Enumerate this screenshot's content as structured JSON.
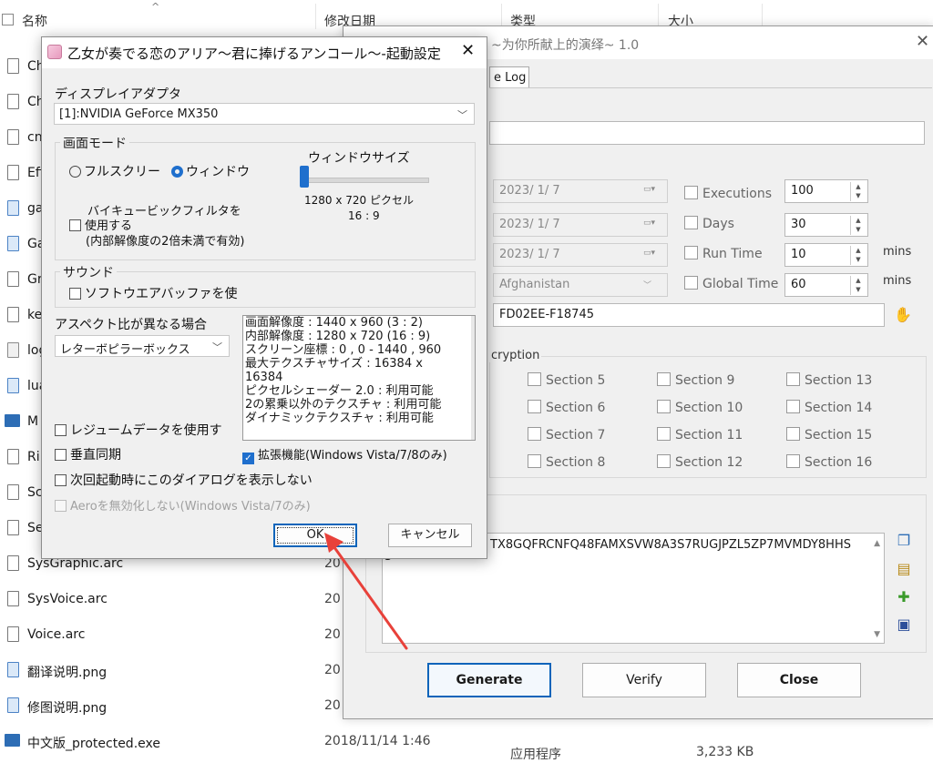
{
  "explorer": {
    "columns": {
      "name": "名称",
      "modified": "修改日期",
      "type": "类型",
      "size": "大小"
    },
    "files": [
      {
        "name": "Ch",
        "icon": "file"
      },
      {
        "name": "Ch",
        "icon": "file"
      },
      {
        "name": "cn",
        "icon": "file"
      },
      {
        "name": "Eff",
        "icon": "file"
      },
      {
        "name": "ga",
        "icon": "image"
      },
      {
        "name": "Ga",
        "icon": "image"
      },
      {
        "name": "Gr",
        "icon": "file"
      },
      {
        "name": "ke",
        "icon": "file"
      },
      {
        "name": "log",
        "icon": "text"
      },
      {
        "name": "lua",
        "icon": "image"
      },
      {
        "name": "M",
        "icon": "exe"
      },
      {
        "name": "Ri",
        "icon": "file"
      },
      {
        "name": "Sc",
        "icon": "file"
      },
      {
        "name": "Se",
        "icon": "file"
      },
      {
        "name": "SysGraphic.arc",
        "icon": "file",
        "date": "20"
      },
      {
        "name": "SysVoice.arc",
        "icon": "file",
        "date": "20"
      },
      {
        "name": "Voice.arc",
        "icon": "file",
        "date": "20"
      },
      {
        "name": "翻译说明.png",
        "icon": "image",
        "date": "20"
      },
      {
        "name": "修图说明.png",
        "icon": "image",
        "date": "20"
      },
      {
        "name": "中文版_protected.exe",
        "icon": "exe",
        "date": "2018/11/14 1:46"
      }
    ],
    "last_row_type": "应用程序",
    "last_row_size": "3,233 KB"
  },
  "keygen": {
    "title": "~为你所献上的演绎~ 1.0",
    "tab": "e Log",
    "dates": [
      "2023/ 1/ 7",
      "2023/ 1/ 7",
      "2023/ 1/ 7"
    ],
    "country": "Afghanistan",
    "hwid": "FD02EE-F18745",
    "checks": {
      "executions": "Executions",
      "days": "Days",
      "run_time": "Run Time",
      "global_time": "Global Time"
    },
    "values": {
      "executions": "100",
      "days": "30",
      "run_time": "10",
      "global_time": "60"
    },
    "units": {
      "mins1": "mins",
      "mins2": "mins"
    },
    "encryption_label": "cryption",
    "sections": [
      "Section 5",
      "Section 6",
      "Section 7",
      "Section 8",
      "Section 9",
      "Section 10",
      "Section 11",
      "Section 12",
      "Section 13",
      "Section 14",
      "Section 15",
      "Section 16"
    ],
    "key_text": "TX8GQFRCNFQ48FAMXSVW8A3S7RUGJPZL5ZP7MVMDY8HHS",
    "key_text_line2": "3",
    "buttons": {
      "generate": "Generate",
      "verify": "Verify",
      "close": "Close"
    }
  },
  "setup": {
    "title": "乙女が奏でる恋のアリア～君に捧げるアンコール～-起動設定",
    "display_adapter_label": "ディスプレイアダプタ",
    "display_adapter_value": "[1]:NVIDIA GeForce MX350",
    "screen_mode_label": "画面モード",
    "fullscreen_label": "フルスクリー",
    "window_label": "ウィンドウ",
    "window_size_label": "ウィンドウサイズ",
    "window_size_value": "1280 x 720 ピクセル",
    "window_aspect": "16 : 9",
    "bicubic_line1": "バイキュービックフィルタを",
    "bicubic_line2": "使用する",
    "bicubic_line3": "(内部解像度の2倍未満で有効)",
    "sound_label": "サウンド",
    "software_buffer_label": "ソフトウエアバッファを使",
    "aspect_label": "アスペクト比が異なる場合",
    "aspect_value": "レターボピラーボックス",
    "info_lines": [
      "画面解像度 : 1440 x 960 (3 : 2)",
      "内部解像度 : 1280 x 720 (16 : 9)",
      "スクリーン座標 : 0 , 0 - 1440 , 960",
      "最大テクスチャサイズ : 16384 x 16384",
      "ピクセルシェーダー 2.0 : 利用可能",
      "2の累乗以外のテクスチャ : 利用可能",
      "ダイナミックテクスチャ : 利用可能"
    ],
    "resume_label": "レジュームデータを使用す",
    "vsync_label": "垂直同期",
    "extended_label": "拡張機能(Windows Vista/7/8のみ)",
    "no_dialog_label": "次回起動時にこのダイアログを表示しない",
    "aero_label": "Aeroを無効化しない(Windows Vista/7のみ)",
    "ok_label": "OK",
    "cancel_label": "キャンセル"
  },
  "colors": {
    "accent": "#1f6fcd",
    "arrow": "#e8413a",
    "default_border": "#0a64ba"
  }
}
